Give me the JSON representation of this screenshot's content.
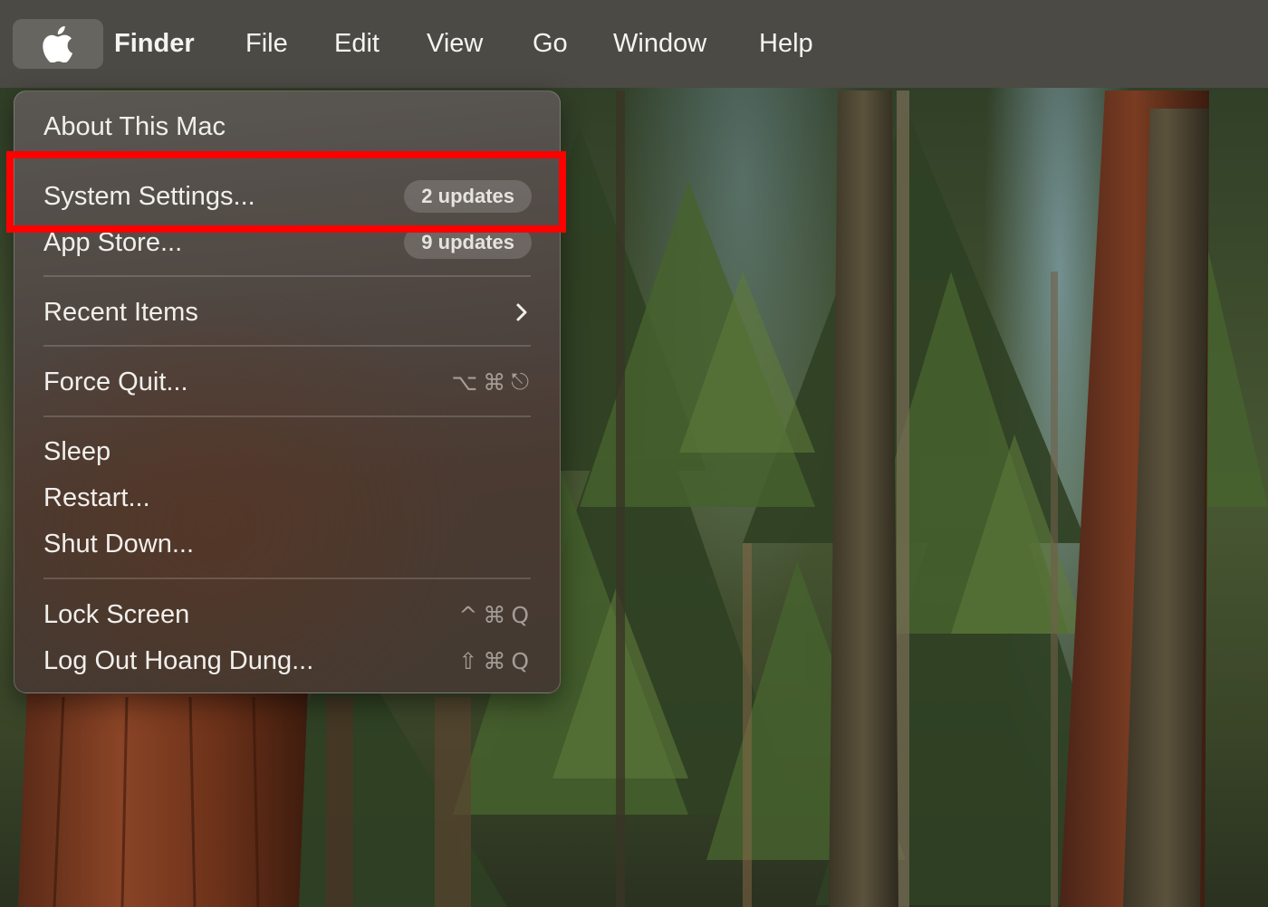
{
  "menubar": {
    "app_name": "Finder",
    "menus": [
      "File",
      "Edit",
      "View",
      "Go",
      "Window",
      "Help"
    ]
  },
  "apple_menu": {
    "about": "About This Mac",
    "system_settings": {
      "label": "System Settings...",
      "badge": "2 updates"
    },
    "app_store": {
      "label": "App Store...",
      "badge": "9 updates"
    },
    "recent_items": "Recent Items",
    "force_quit": {
      "label": "Force Quit...",
      "shortcut": [
        "⌥",
        "⌘",
        "⎋"
      ]
    },
    "sleep": "Sleep",
    "restart": "Restart...",
    "shut_down": "Shut Down...",
    "lock_screen": {
      "label": "Lock Screen",
      "shortcut": [
        "^",
        "⌘",
        "Q"
      ]
    },
    "log_out": {
      "label": "Log Out Hoang Dung...",
      "shortcut": [
        "⇧",
        "⌘",
        "Q"
      ]
    }
  },
  "annotation": {
    "highlight_color": "#ff0000",
    "highlighted_item": "System Settings..."
  },
  "colors": {
    "menubar": "#4b4a44",
    "menu_text": "#f1efec",
    "shortcut_text": "#a49d97"
  }
}
